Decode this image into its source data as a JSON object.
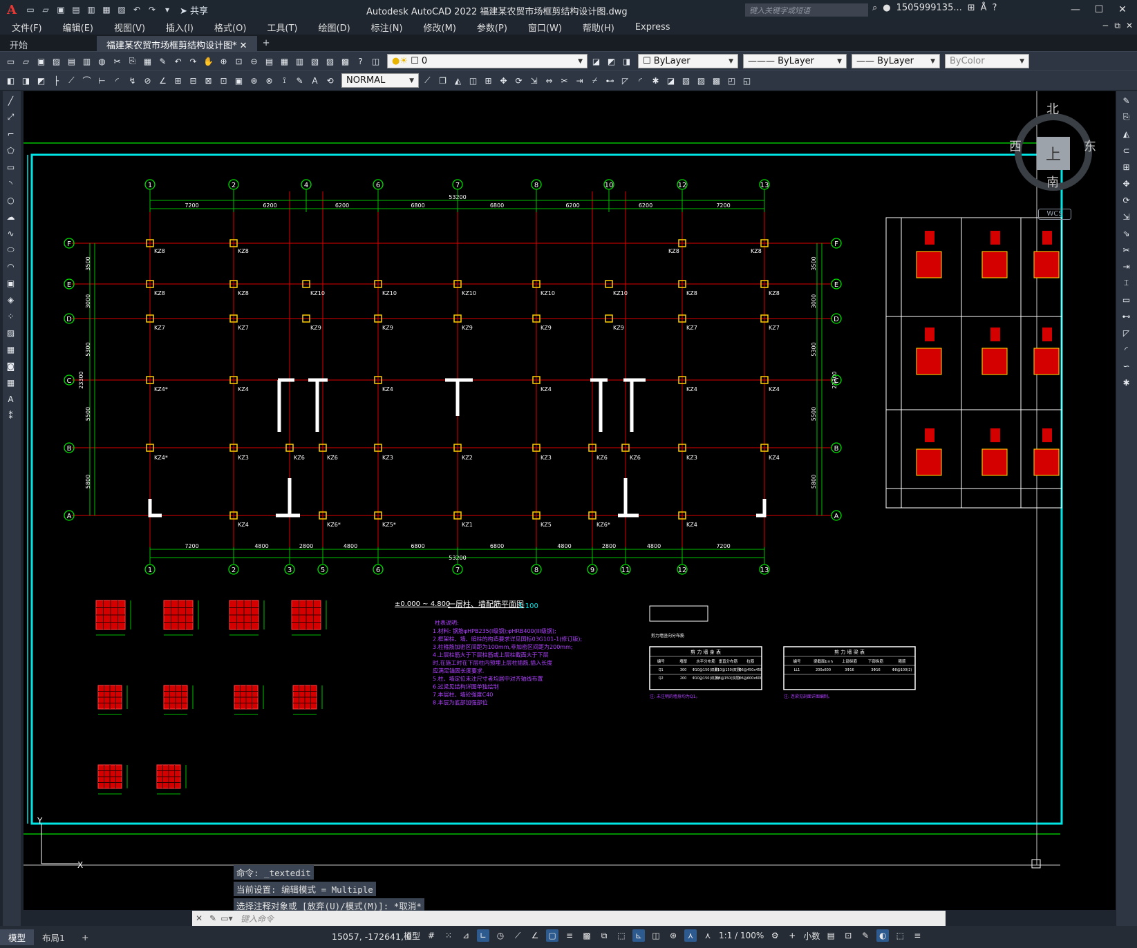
{
  "app": {
    "logo": "A",
    "title": "Autodesk AutoCAD 2022    福建某农贸市场框剪结构设计图.dwg",
    "share": "共享",
    "search_placeholder": "键入关键字或短语",
    "user": "1505999135...",
    "help": "?"
  },
  "menu": [
    "文件(F)",
    "编辑(E)",
    "视图(V)",
    "插入(I)",
    "格式(O)",
    "工具(T)",
    "绘图(D)",
    "标注(N)",
    "修改(M)",
    "参数(P)",
    "窗口(W)",
    "帮助(H)",
    "Express"
  ],
  "tabs": [
    "开始",
    "福建某农贸市场框剪结构设计图*"
  ],
  "toolbar": {
    "layer_value": "0",
    "color": "ByLayer",
    "linetype": "ByLayer",
    "lineweight": "ByLayer",
    "plotstyle": "ByColor",
    "textstyle": "NORMAL"
  },
  "viewcube": {
    "north": "北",
    "south": "南",
    "east": "东",
    "west": "西",
    "top": "上",
    "wcs": "WCS"
  },
  "drawing": {
    "axes_top": [
      "1",
      "2",
      "4",
      "6",
      "7",
      "8",
      "10",
      "12",
      "13"
    ],
    "axes_bottom": [
      "1",
      "2",
      "3",
      "5",
      "6",
      "7",
      "8",
      "9",
      "11",
      "12",
      "13"
    ],
    "axes_rows": [
      "F",
      "E",
      "D",
      "C",
      "B",
      "A"
    ],
    "dims_top": [
      "7200",
      "6200",
      "6200",
      "6800",
      "6800",
      "6200",
      "6200",
      "7200"
    ],
    "dims_bottom": [
      "7200",
      "4800",
      "2800",
      "4800",
      "6800",
      "6800",
      "4800",
      "2800",
      "4800",
      "7200"
    ],
    "total": "53200",
    "left_dims": [
      "3500",
      "3000",
      "5300",
      "5500",
      "5800"
    ],
    "left_total": "23300",
    "col_tags_F": [
      "KZ8",
      "KZ8",
      "KZ8",
      "KZ8"
    ],
    "col_tags_E": [
      "KZ8",
      "KZ8",
      "KZ10",
      "KZ10",
      "KZ10",
      "KZ10",
      "KZ10",
      "KZ8",
      "KZ8"
    ],
    "col_tags_D": [
      "KZ7",
      "KZ7",
      "KZ9",
      "KZ9",
      "KZ9",
      "KZ9",
      "KZ9",
      "KZ7",
      "KZ7"
    ],
    "col_tags_C": [
      "KZ4*",
      "KZ4",
      "KZ4",
      "KZ4",
      "KZ4",
      "KZ4"
    ],
    "col_tags_B": [
      "KZ4*",
      "KZ3",
      "KZ6",
      "KZ6",
      "KZ3",
      "KZ2",
      "KZ3",
      "KZ6",
      "KZ6",
      "KZ3",
      "KZ4"
    ],
    "col_tags_A": [
      "KZ4",
      "KZ6*",
      "KZ5*",
      "KZ1",
      "KZ5",
      "KZ6*",
      "KZ4"
    ],
    "plan_title": "一层柱、墙配筋平面图",
    "plan_level": "±0.000 ~ 4.800",
    "plan_scale": "1:100",
    "notes_title": "柱表说明:",
    "notes": [
      "1.材料: 钢筋φHPB235(I级钢);φHRB400(III级钢);",
      "2.框架柱、墙、暗柱的构造要求详见国标03G101-1(修订版);",
      "3.柱箍筋加密区间距为100mm,非加密区间距为200mm;",
      "4.上层柱筋大于下层柱筋或上层柱截面大于下层",
      "  时,在施工时在下层柱内预埋上层柱插筋,插入长度",
      "  应满足锚固长度要求.",
      "5.柱、墙定位未注尺寸者均居中对齐轴线布置",
      "6.过梁见结构详图单独绘制",
      "7.本层柱、墙砼强度C40",
      "8.本层为底部加强部位"
    ],
    "wall_table1_title": "剪 力 墙 身 表",
    "wall_table1_head": [
      "编号",
      "墙厚",
      "水平分布筋",
      "垂直分布筋",
      "拉筋"
    ],
    "wall_table1_rows": [
      [
        "Q1",
        "300",
        "Φ10@150(双层)",
        "Φ10@150(双层)",
        "Φ6@450x450"
      ],
      [
        "Q2",
        "200",
        "Φ10@150(双层)",
        "Φ8@150(双层)",
        "Φ6@600x600"
      ]
    ],
    "wall_table1_note": "注: 未注明的墙身均为Q1。",
    "wall_table2_title": "剪 力 墙 梁 表",
    "wall_table2_head": [
      "编号",
      "梁截面b×h",
      "上部纵筋",
      "下部纵筋",
      "箍筋"
    ],
    "wall_table2_rows": [
      [
        "LL1",
        "200x600",
        "3Φ16",
        "3Φ16",
        "Φ8@100(2)"
      ]
    ],
    "wall_table2_note": "注: 连梁见剖面详图编制。",
    "section_label": "剪力墙竖向分布筋"
  },
  "cmd": {
    "history": [
      "命令: _textedit",
      "当前设置: 编辑模式 = Multiple",
      "选择注释对象或 [放弃(U)/模式(M)]: *取消*"
    ],
    "placeholder": "键入命令"
  },
  "status": {
    "tabs": [
      "模型",
      "布局1"
    ],
    "plus": "+",
    "coords": "15057, -172641, 0",
    "model": "模型",
    "scale": "1:1 / 100%",
    "units": "小数"
  }
}
